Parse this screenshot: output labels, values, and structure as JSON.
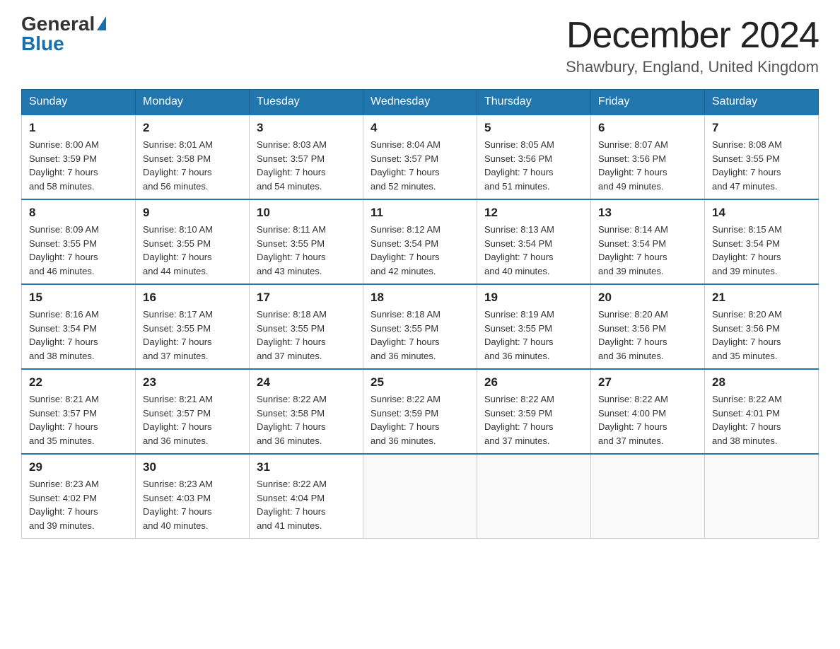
{
  "header": {
    "logo_general": "General",
    "logo_blue": "Blue",
    "month_title": "December 2024",
    "location": "Shawbury, England, United Kingdom"
  },
  "days_of_week": [
    "Sunday",
    "Monday",
    "Tuesday",
    "Wednesday",
    "Thursday",
    "Friday",
    "Saturday"
  ],
  "weeks": [
    [
      {
        "num": "1",
        "rise": "8:00 AM",
        "set": "3:59 PM",
        "hours": "7",
        "mins": "58"
      },
      {
        "num": "2",
        "rise": "8:01 AM",
        "set": "3:58 PM",
        "hours": "7",
        "mins": "56"
      },
      {
        "num": "3",
        "rise": "8:03 AM",
        "set": "3:57 PM",
        "hours": "7",
        "mins": "54"
      },
      {
        "num": "4",
        "rise": "8:04 AM",
        "set": "3:57 PM",
        "hours": "7",
        "mins": "52"
      },
      {
        "num": "5",
        "rise": "8:05 AM",
        "set": "3:56 PM",
        "hours": "7",
        "mins": "51"
      },
      {
        "num": "6",
        "rise": "8:07 AM",
        "set": "3:56 PM",
        "hours": "7",
        "mins": "49"
      },
      {
        "num": "7",
        "rise": "8:08 AM",
        "set": "3:55 PM",
        "hours": "7",
        "mins": "47"
      }
    ],
    [
      {
        "num": "8",
        "rise": "8:09 AM",
        "set": "3:55 PM",
        "hours": "7",
        "mins": "46"
      },
      {
        "num": "9",
        "rise": "8:10 AM",
        "set": "3:55 PM",
        "hours": "7",
        "mins": "44"
      },
      {
        "num": "10",
        "rise": "8:11 AM",
        "set": "3:55 PM",
        "hours": "7",
        "mins": "43"
      },
      {
        "num": "11",
        "rise": "8:12 AM",
        "set": "3:54 PM",
        "hours": "7",
        "mins": "42"
      },
      {
        "num": "12",
        "rise": "8:13 AM",
        "set": "3:54 PM",
        "hours": "7",
        "mins": "40"
      },
      {
        "num": "13",
        "rise": "8:14 AM",
        "set": "3:54 PM",
        "hours": "7",
        "mins": "39"
      },
      {
        "num": "14",
        "rise": "8:15 AM",
        "set": "3:54 PM",
        "hours": "7",
        "mins": "39"
      }
    ],
    [
      {
        "num": "15",
        "rise": "8:16 AM",
        "set": "3:54 PM",
        "hours": "7",
        "mins": "38"
      },
      {
        "num": "16",
        "rise": "8:17 AM",
        "set": "3:55 PM",
        "hours": "7",
        "mins": "37"
      },
      {
        "num": "17",
        "rise": "8:18 AM",
        "set": "3:55 PM",
        "hours": "7",
        "mins": "37"
      },
      {
        "num": "18",
        "rise": "8:18 AM",
        "set": "3:55 PM",
        "hours": "7",
        "mins": "36"
      },
      {
        "num": "19",
        "rise": "8:19 AM",
        "set": "3:55 PM",
        "hours": "7",
        "mins": "36"
      },
      {
        "num": "20",
        "rise": "8:20 AM",
        "set": "3:56 PM",
        "hours": "7",
        "mins": "36"
      },
      {
        "num": "21",
        "rise": "8:20 AM",
        "set": "3:56 PM",
        "hours": "7",
        "mins": "35"
      }
    ],
    [
      {
        "num": "22",
        "rise": "8:21 AM",
        "set": "3:57 PM",
        "hours": "7",
        "mins": "35"
      },
      {
        "num": "23",
        "rise": "8:21 AM",
        "set": "3:57 PM",
        "hours": "7",
        "mins": "36"
      },
      {
        "num": "24",
        "rise": "8:22 AM",
        "set": "3:58 PM",
        "hours": "7",
        "mins": "36"
      },
      {
        "num": "25",
        "rise": "8:22 AM",
        "set": "3:59 PM",
        "hours": "7",
        "mins": "36"
      },
      {
        "num": "26",
        "rise": "8:22 AM",
        "set": "3:59 PM",
        "hours": "7",
        "mins": "37"
      },
      {
        "num": "27",
        "rise": "8:22 AM",
        "set": "4:00 PM",
        "hours": "7",
        "mins": "37"
      },
      {
        "num": "28",
        "rise": "8:22 AM",
        "set": "4:01 PM",
        "hours": "7",
        "mins": "38"
      }
    ],
    [
      {
        "num": "29",
        "rise": "8:23 AM",
        "set": "4:02 PM",
        "hours": "7",
        "mins": "39"
      },
      {
        "num": "30",
        "rise": "8:23 AM",
        "set": "4:03 PM",
        "hours": "7",
        "mins": "40"
      },
      {
        "num": "31",
        "rise": "8:22 AM",
        "set": "4:04 PM",
        "hours": "7",
        "mins": "41"
      },
      null,
      null,
      null,
      null
    ]
  ]
}
